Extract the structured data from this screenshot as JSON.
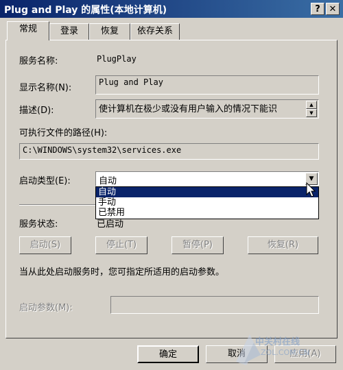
{
  "window": {
    "title": "Plug and Play 的属性(本地计算机)",
    "help_button": "?",
    "close_button": "X"
  },
  "tabs": [
    {
      "label": "常规",
      "active": true
    },
    {
      "label": "登录",
      "active": false
    },
    {
      "label": "恢复",
      "active": false
    },
    {
      "label": "依存关系",
      "active": false
    }
  ],
  "general": {
    "service_name_label": "服务名称:",
    "service_name_value": "PlugPlay",
    "display_name_label": "显示名称(N):",
    "display_name_value": "Plug and Play",
    "description_label": "描述(D):",
    "description_value": "使计算机在极少或没有用户输入的情况下能识",
    "exe_path_label": "可执行文件的路径(H):",
    "exe_path_value": "C:\\WINDOWS\\system32\\services.exe",
    "startup_type_label": "启动类型(E):",
    "startup_type_value": "自动",
    "startup_type_options": [
      "自动",
      "手动",
      "已禁用"
    ],
    "service_status_label": "服务状态:",
    "service_status_value": "已启动",
    "start_button": "启动(S)",
    "stop_button": "停止(T)",
    "pause_button": "暂停(P)",
    "resume_button": "恢复(R)",
    "hint_text": "当从此处启动服务时，您可指定所适用的启动参数。",
    "start_params_label": "启动参数(M):",
    "start_params_value": ""
  },
  "footer": {
    "ok_button": "确定",
    "cancel_button": "取消",
    "apply_button": "应用(A)"
  },
  "watermark": {
    "line1": "中关村在线",
    "line2": "ZOL.COM.CN"
  },
  "colors": {
    "title_bar_start": "#0a246a",
    "title_bar_end": "#3a6ea5",
    "face": "#d4d0c8",
    "selection": "#0a246a"
  }
}
